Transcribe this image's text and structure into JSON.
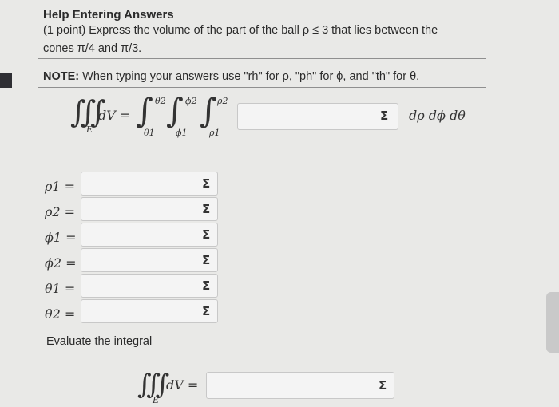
{
  "header": {
    "title": "Help Entering Answers",
    "question_line1": "(1 point) Express the volume of the part of the ball ρ ≤ 3 that lies between the",
    "question_line2": "cones π/4 and π/3."
  },
  "note": {
    "label": "NOTE:",
    "text": " When typing your answers use \"rh\" for ρ, \"ph\" for ϕ, and \"th\" for θ."
  },
  "integral": {
    "lhs": "dV =",
    "triple_int": "∭",
    "region": "E",
    "outer_upper": "θ2",
    "outer_lower": "θ1",
    "middle_upper": "ϕ2",
    "middle_lower": "ϕ1",
    "inner_upper": "ρ2",
    "inner_lower": "ρ1",
    "integrand_value": "",
    "differentials": "dρ dϕ dθ"
  },
  "limits": [
    {
      "label": "ρ1 =",
      "value": ""
    },
    {
      "label": "ρ2 =",
      "value": ""
    },
    {
      "label": "ϕ1 =",
      "value": ""
    },
    {
      "label": "ϕ2 =",
      "value": ""
    },
    {
      "label": "θ1 =",
      "value": ""
    },
    {
      "label": "θ2 =",
      "value": ""
    }
  ],
  "evaluate": {
    "label": "Evaluate the integral",
    "lhs": "dV =",
    "region": "E",
    "triple_int": "∭",
    "value": ""
  },
  "icons": {
    "sigma": "Σ"
  }
}
